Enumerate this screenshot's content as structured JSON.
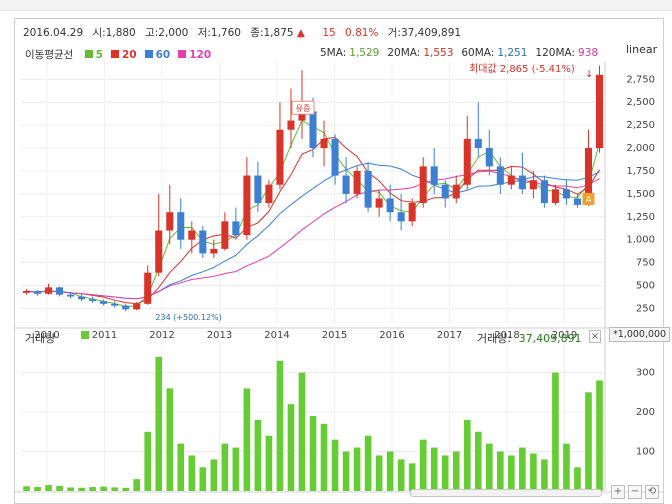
{
  "header": {
    "date": "2016.04.29",
    "open_label": "시:",
    "open": "1,880",
    "high_label": "고:",
    "high": "2,000",
    "low_label": "저:",
    "low": "1,760",
    "close_label": "종:",
    "close": "1,875",
    "change_arrow": "▲",
    "change": "15",
    "change_pct": "0.81%",
    "volume_label": "거:",
    "volume": "37,409,891"
  },
  "ma_legend": {
    "title": "이동평균선",
    "items": [
      {
        "label": "5",
        "color": "#66bb33"
      },
      {
        "label": "20",
        "color": "#d8342a"
      },
      {
        "label": "60",
        "color": "#3d7fd0"
      },
      {
        "label": "120",
        "color": "#e040b0"
      }
    ],
    "values": [
      {
        "name": "5MA:",
        "value": "1,529",
        "color": "#5aa02c"
      },
      {
        "name": "20MA:",
        "value": "1,553",
        "color": "#c8321f"
      },
      {
        "name": "60MA:",
        "value": "1,251",
        "color": "#2e6db8"
      },
      {
        "name": "120MA:",
        "value": "938",
        "color": "#d838a8"
      }
    ]
  },
  "scale_toggle": "linear",
  "max_label": "최대값 2,865 (-5.41%)",
  "max_arrow": "↓",
  "annotation_label": "유증",
  "annotation_sub": "234 (+500.12%)",
  "marker_a": "A",
  "volume_panel": {
    "title": "거래량",
    "value_label": "거래량:",
    "value": "37,409,891",
    "close_symbol": "×",
    "unit": "*1,000,000"
  },
  "controls": {
    "zoom_in": "+",
    "zoom_out": "−",
    "reset": "⟲"
  },
  "colors": {
    "up": "#d8342a",
    "down": "#3d7fd0",
    "volume": "#66cc33"
  },
  "chart_data": {
    "type": "candlestick",
    "y_ticks": [
      "2,750",
      "2,500",
      "2,250",
      "2,000",
      "1,750",
      "1,500",
      "1,250",
      "1,000",
      "750",
      "500",
      "250"
    ],
    "y_values": [
      2750,
      2500,
      2250,
      2000,
      1750,
      1500,
      1250,
      1000,
      750,
      500,
      250
    ],
    "ylim": [
      80,
      2950
    ],
    "x_ticks": [
      "2010",
      "2011",
      "2012",
      "2013",
      "2014",
      "2015",
      "2016",
      "2017",
      "2018",
      "2019"
    ],
    "volume_ticks": [
      "300",
      "200",
      "100"
    ],
    "volume_values": [
      300,
      200,
      100
    ],
    "volume_ylim": [
      0,
      380
    ],
    "candles": [
      [
        420,
        460,
        400,
        440
      ],
      [
        440,
        450,
        390,
        410
      ],
      [
        410,
        520,
        400,
        480
      ],
      [
        480,
        490,
        380,
        400
      ],
      [
        400,
        430,
        360,
        380
      ],
      [
        380,
        400,
        330,
        350
      ],
      [
        350,
        380,
        310,
        330
      ],
      [
        330,
        350,
        280,
        300
      ],
      [
        300,
        330,
        260,
        280
      ],
      [
        280,
        300,
        220,
        240
      ],
      [
        240,
        320,
        230,
        300
      ],
      [
        300,
        720,
        290,
        640
      ],
      [
        640,
        1500,
        600,
        1100
      ],
      [
        1100,
        1600,
        950,
        1300
      ],
      [
        1300,
        1450,
        900,
        1000
      ],
      [
        1000,
        1200,
        850,
        1100
      ],
      [
        1100,
        1150,
        800,
        850
      ],
      [
        850,
        1000,
        800,
        900
      ],
      [
        900,
        1300,
        880,
        1200
      ],
      [
        1200,
        1350,
        1000,
        1050
      ],
      [
        1050,
        1900,
        1000,
        1700
      ],
      [
        1700,
        1850,
        1300,
        1400
      ],
      [
        1400,
        1650,
        1350,
        1600
      ],
      [
        1600,
        2500,
        1550,
        2200
      ],
      [
        2200,
        2650,
        2000,
        2300
      ],
      [
        2300,
        2850,
        2100,
        2400
      ],
      [
        2400,
        2550,
        1900,
        2000
      ],
      [
        2000,
        2300,
        1800,
        2100
      ],
      [
        2100,
        2150,
        1600,
        1700
      ],
      [
        1700,
        1900,
        1400,
        1500
      ],
      [
        1500,
        1800,
        1450,
        1750
      ],
      [
        1750,
        1850,
        1300,
        1350
      ],
      [
        1350,
        1550,
        1250,
        1450
      ],
      [
        1450,
        1600,
        1200,
        1300
      ],
      [
        1300,
        1500,
        1100,
        1200
      ],
      [
        1200,
        1450,
        1150,
        1400
      ],
      [
        1400,
        1900,
        1350,
        1800
      ],
      [
        1800,
        2000,
        1500,
        1600
      ],
      [
        1600,
        1650,
        1350,
        1450
      ],
      [
        1450,
        1700,
        1400,
        1600
      ],
      [
        1600,
        2350,
        1550,
        2100
      ],
      [
        2100,
        2500,
        1900,
        2000
      ],
      [
        2000,
        2200,
        1700,
        1800
      ],
      [
        1800,
        1900,
        1500,
        1600
      ],
      [
        1600,
        1800,
        1550,
        1700
      ],
      [
        1700,
        1950,
        1500,
        1550
      ],
      [
        1550,
        1750,
        1450,
        1650
      ],
      [
        1650,
        1700,
        1350,
        1400
      ],
      [
        1400,
        1600,
        1380,
        1550
      ],
      [
        1550,
        1650,
        1380,
        1450
      ],
      [
        1450,
        1500,
        1350,
        1380
      ],
      [
        1380,
        2200,
        1370,
        2000
      ],
      [
        2000,
        2900,
        1950,
        2800
      ]
    ],
    "volumes": [
      12,
      10,
      15,
      13,
      9,
      8,
      10,
      11,
      9,
      8,
      30,
      150,
      340,
      260,
      120,
      90,
      60,
      80,
      120,
      110,
      260,
      180,
      140,
      330,
      220,
      300,
      190,
      170,
      130,
      100,
      110,
      140,
      90,
      100,
      80,
      70,
      130,
      110,
      90,
      100,
      180,
      150,
      120,
      100,
      90,
      110,
      95,
      80,
      300,
      120,
      60,
      250,
      280
    ]
  }
}
